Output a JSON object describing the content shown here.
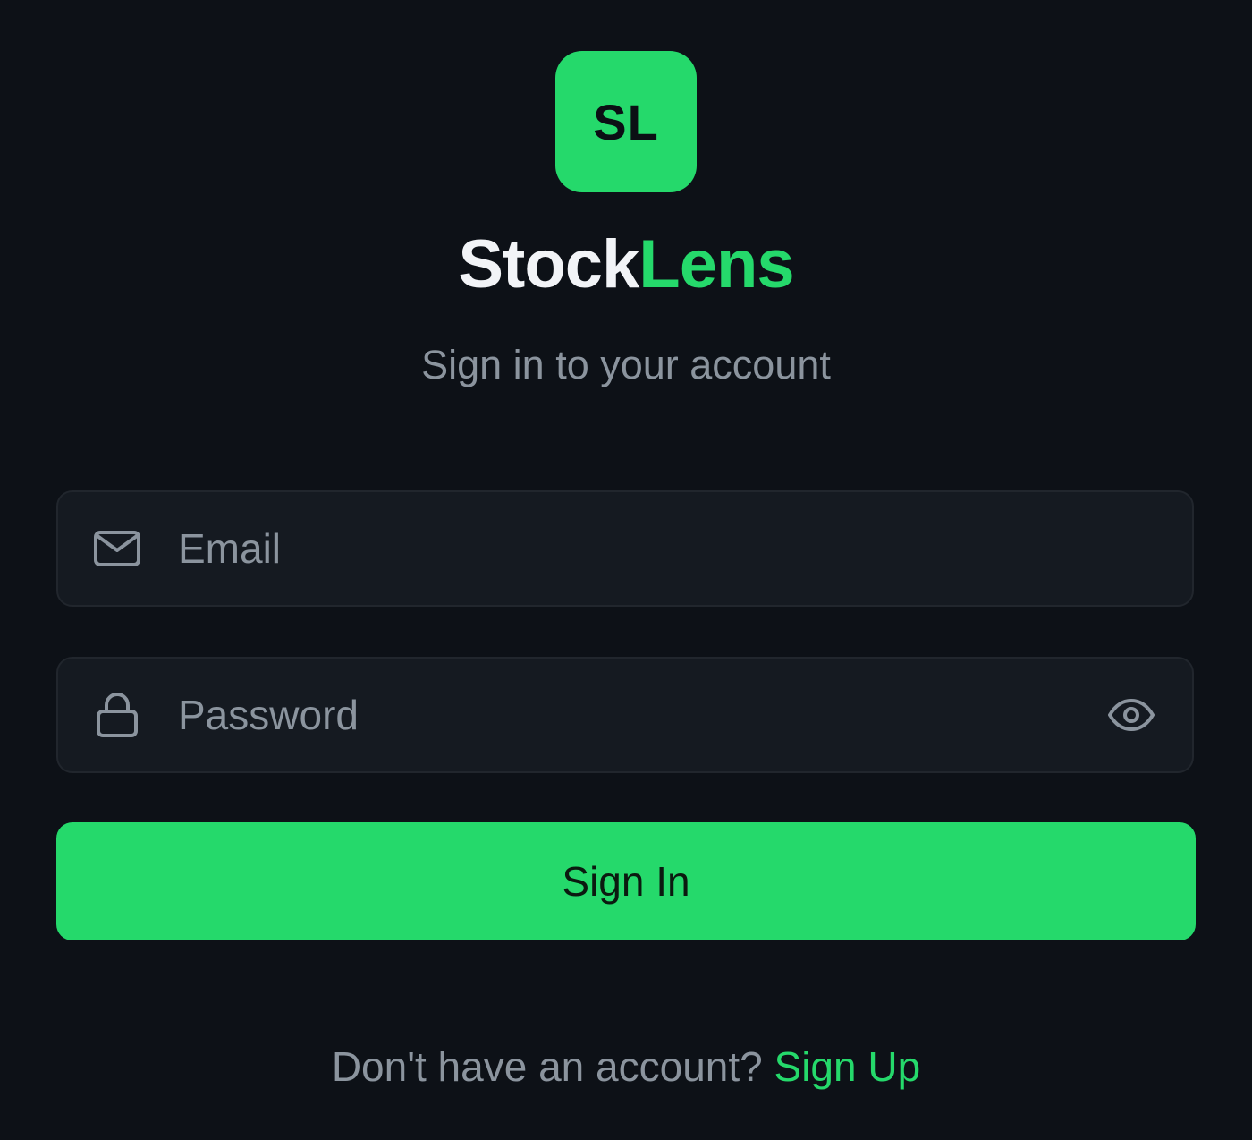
{
  "logo": {
    "initials": "SL"
  },
  "brand": {
    "part1": "Stock",
    "part2": "Lens"
  },
  "subtitle": "Sign in to your account",
  "form": {
    "email": {
      "placeholder": "Email",
      "value": "",
      "icon": "mail-icon"
    },
    "password": {
      "placeholder": "Password",
      "value": "",
      "icon": "lock-icon",
      "toggle_icon": "eye-icon"
    },
    "submit_label": "Sign In"
  },
  "footer": {
    "prompt": "Don't have an account?",
    "link_label": "Sign Up"
  },
  "colors": {
    "background": "#0d1117",
    "accent": "#25d96b",
    "field_bg": "#151a21",
    "muted_text": "#8b949e"
  }
}
